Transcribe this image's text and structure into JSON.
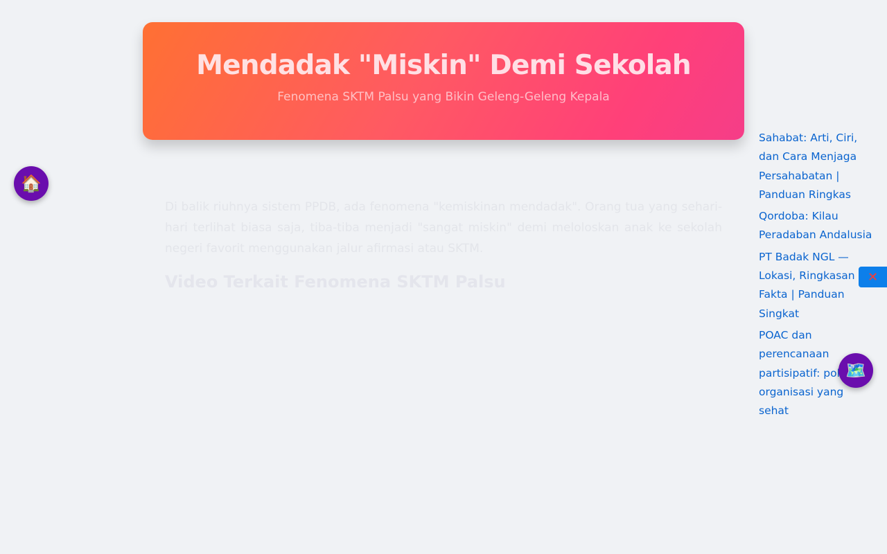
{
  "hero": {
    "title": "Mendadak \"Miskin\" Demi Sekolah",
    "subtitle": "Fenomena SKTM Palsu yang Bikin Geleng-Geleng Kepala"
  },
  "article": {
    "intro": "Di balik riuhnya sistem PPDB, ada fenomena \"kemiskinan mendadak\". Orang tua yang sehari-hari terlihat biasa saja, tiba-tiba menjadi \"sangat miskin\" demi meloloskan anak ke sekolah negeri favorit menggunakan jalur afirmasi atau SKTM.",
    "section_heading": "Video Terkait Fenomena SKTM Palsu"
  },
  "related_links": [
    {
      "text": "Sahabat: Arti, Ciri,\ndan Cara Menjaga\nPersahabatan |\nPanduan Ringkas"
    },
    {
      "text": "Qordoba: Kilau\nPeradaban Andalusia"
    },
    {
      "text": "PT Badak NGL —\nLokasi, Ringkasan &\nFakta | Panduan\nSingkat"
    },
    {
      "text": "POAC dan\nperencanaan\npartisipatif: pola\norganisasi yang\nsehat"
    }
  ],
  "icons": {
    "home": "🏠",
    "map": "🗺️",
    "close": "✕"
  },
  "colors": {
    "accent_purple": "#6a0dad",
    "link_blue": "#0a64cf",
    "close_tab_blue": "#0d7fea",
    "close_red": "#ff3b30",
    "gradient_start": "#ff7033",
    "gradient_end": "#f53d88"
  }
}
